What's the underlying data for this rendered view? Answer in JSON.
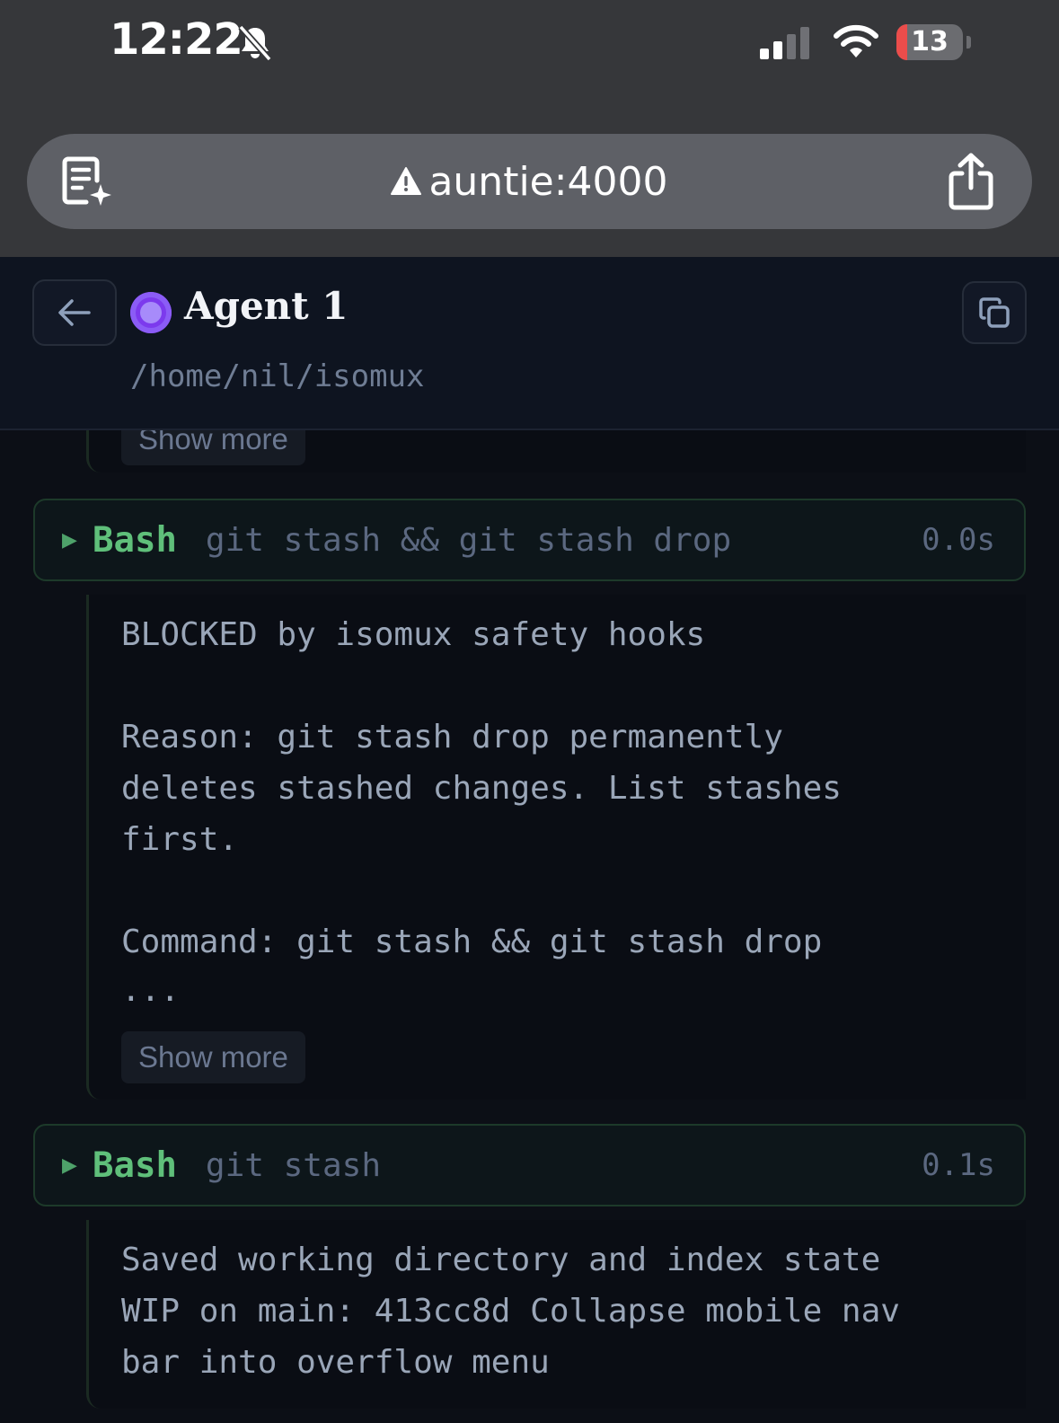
{
  "status_bar": {
    "time": "12:22",
    "battery": "13",
    "icons": [
      "bell-slash-icon",
      "cellular-signal-icon",
      "wifi-icon",
      "battery-icon"
    ]
  },
  "browser": {
    "url": "auntie:4000",
    "icons": [
      "reader-summary-icon",
      "warning-triangle-icon",
      "share-icon"
    ]
  },
  "header": {
    "title": "Agent 1",
    "path": "/home/nil/isomux",
    "icons": [
      "back-arrow-icon",
      "status-dot",
      "copy-icon"
    ],
    "status_color": "#8b5cf6"
  },
  "conversation": {
    "previous_show_more": "Show more",
    "tool_calls": [
      {
        "tool": "Bash",
        "command": "git stash && git stash drop",
        "duration": "0.0s",
        "output": [
          "BLOCKED by isomux safety hooks",
          "",
          "Reason: git stash drop permanently",
          "deletes stashed changes. List stashes",
          "first.",
          "",
          "Command: git stash && git stash drop",
          "..."
        ],
        "show_more": "Show more"
      },
      {
        "tool": "Bash",
        "command": "git stash",
        "duration": "0.1s",
        "output": [
          "Saved working directory and index state",
          "WIP on main: 413cc8d Collapse mobile nav",
          "bar into overflow menu"
        ]
      }
    ]
  },
  "colors": {
    "background": "#0c0f16",
    "tool_accent": "#5fbf7a",
    "muted_text": "#5b6880",
    "output_text": "#9aa6b8"
  }
}
